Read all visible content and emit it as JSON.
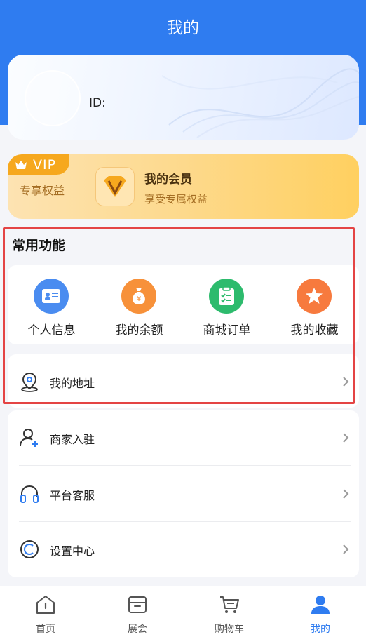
{
  "header": {
    "title": "我的"
  },
  "profile": {
    "id_label": "ID:"
  },
  "vip": {
    "badge": "VIP",
    "subtitle": "专享权益",
    "title": "我的会员",
    "description": "享受专属权益"
  },
  "common": {
    "title": "常用功能",
    "items": [
      {
        "label": "个人信息",
        "icon": "id-card-icon",
        "color": "#4a8cf0"
      },
      {
        "label": "我的余额",
        "icon": "money-bag-icon",
        "color": "#f7913a"
      },
      {
        "label": "商城订单",
        "icon": "clipboard-icon",
        "color": "#2dbb6d"
      },
      {
        "label": "我的收藏",
        "icon": "star-icon",
        "color": "#f77a3e"
      }
    ]
  },
  "address": {
    "label": "我的地址",
    "icon": "location-pin-icon"
  },
  "menu": [
    {
      "label": "商家入驻",
      "icon": "add-user-icon"
    },
    {
      "label": "平台客服",
      "icon": "headphones-icon"
    },
    {
      "label": "设置中心",
      "icon": "settings-icon"
    }
  ],
  "tabbar": {
    "active_color": "#2f7cf0",
    "items": [
      {
        "label": "首页",
        "icon": "home-icon"
      },
      {
        "label": "展会",
        "icon": "box-icon"
      },
      {
        "label": "购物车",
        "icon": "cart-icon"
      },
      {
        "label": "我的",
        "icon": "user-icon",
        "active": true
      }
    ]
  }
}
